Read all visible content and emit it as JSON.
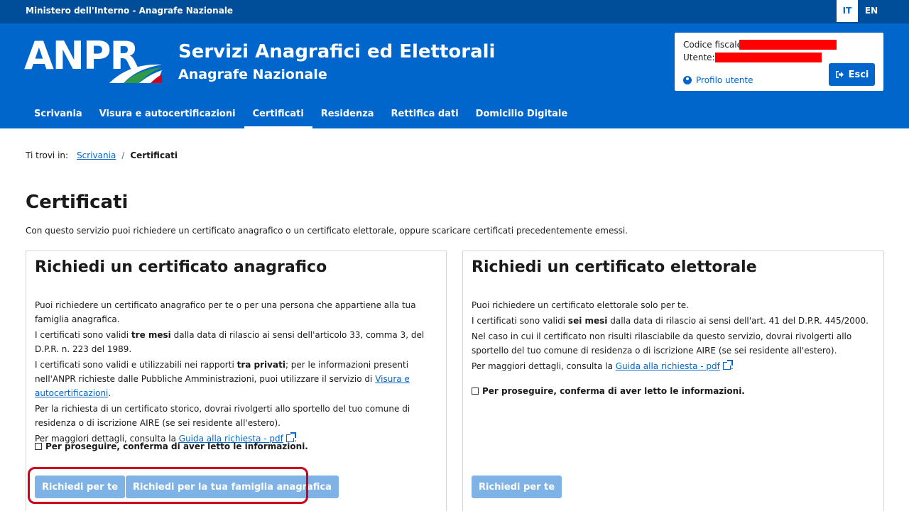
{
  "topbar": {
    "ministry": "Ministero dell'Interno - Anagrafe Nazionale",
    "lang_it": "IT",
    "lang_en": "EN"
  },
  "header": {
    "logo": "ANPR",
    "title": "Servizi Anagrafici ed Elettorali",
    "subtitle": "Anagrafe Nazionale"
  },
  "user": {
    "cf_label": "Codice fiscale:",
    "user_label": "Utente:",
    "profile": "Profilo utente",
    "logout": "Esci"
  },
  "nav": [
    "Scrivania",
    "Visura e autocertificazioni",
    "Certificati",
    "Residenza",
    "Rettifica dati",
    "Domicilio Digitale"
  ],
  "breadcrumb": {
    "prefix": "Ti trovi in:",
    "home": "Scrivania",
    "sep": "/",
    "current": "Certificati"
  },
  "page": {
    "title": "Certificati",
    "intro": "Con questo servizio puoi richiedere un certificato anagrafico o un certificato elettorale, oppure scaricare certificati precedentemente emessi."
  },
  "card_anagrafico": {
    "title": "Richiedi un certificato anagrafico",
    "p1": "Puoi richiedere un certificato anagrafico per te o per una persona che appartiene alla tua famiglia anagrafica.",
    "p2a": "I certificati sono validi ",
    "p2b": "tre mesi",
    "p2c": " dalla data di rilascio ai sensi dell'articolo 33, comma 3, del D.P.R. n. 223 del 1989.",
    "p3a": "I certificati sono validi e utilizzabili nei rapporti ",
    "p3b": "tra privati",
    "p3c": "; per le informazioni presenti nell'ANPR richieste dalle Pubbliche Amministrazioni, puoi utilizzare il servizio di ",
    "p3link": "Visura e autocertificazioni",
    "p3d": ".",
    "p4": "Per la richiesta di un certificato storico, dovrai rivolgerti allo sportello del tuo comune di residenza o di iscrizione AIRE (se sei residente all'estero).",
    "p5a": "Per maggiori dettagli, consulta la ",
    "p5link": "Guida alla richiesta - pdf",
    "p5b": ".",
    "confirm": "Per proseguire, conferma di aver letto le informazioni.",
    "btn_self": "Richiedi per te",
    "btn_family": "Richiedi per la tua famiglia anagrafica"
  },
  "card_elettorale": {
    "title": "Richiedi un certificato elettorale",
    "p1": "Puoi richiedere un certificato elettorale solo per te.",
    "p2a": "I certificati sono validi ",
    "p2b": "sei mesi",
    "p2c": " dalla data di rilascio ai sensi dell'art. 41 del D.P.R. 445/2000.",
    "p3": "Nel caso in cui il certificato non risulti rilasciabile da questo servizio, dovrai rivolgerti allo sportello del tuo comune di residenza o di iscrizione AIRE (se sei residente all'estero).",
    "p4a": "Per maggiori dettagli, consulta la ",
    "p4link": "Guida alla richiesta - pdf",
    "p4b": ".",
    "confirm": "Per proseguire, conferma di aver letto le informazioni.",
    "btn_self": "Richiedi per te"
  },
  "colors": {
    "primary": "#0066cc",
    "topbar": "#004d99",
    "disabled_btn": "#7fb2e5",
    "highlight": "#d0021b",
    "redaction": "#ff0000"
  }
}
